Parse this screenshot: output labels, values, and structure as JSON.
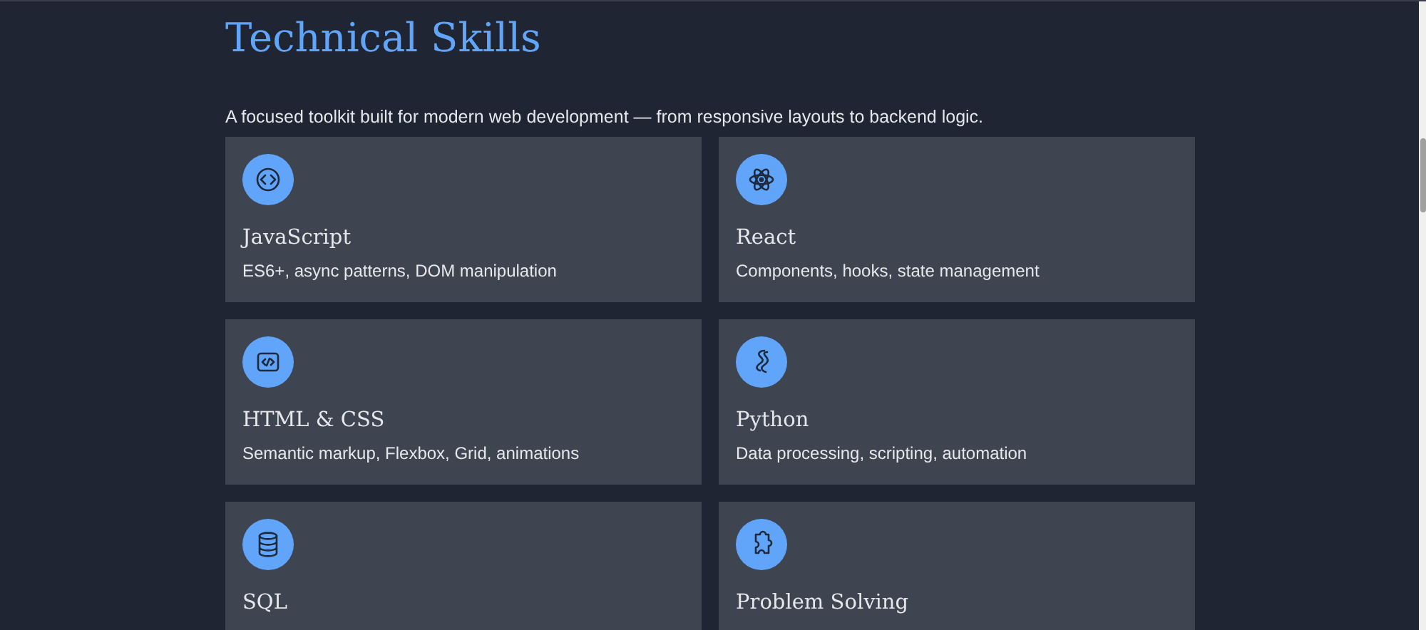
{
  "section": {
    "title": "Technical Skills",
    "subtitle": "A focused toolkit built for modern web development — from responsive layouts to backend logic."
  },
  "skills": [
    {
      "name": "JavaScript",
      "description": "ES6+, async patterns, DOM manipulation"
    },
    {
      "name": "React",
      "description": "Components, hooks, state management"
    },
    {
      "name": "HTML & CSS",
      "description": "Semantic markup, Flexbox, Grid, animations"
    },
    {
      "name": "Python",
      "description": "Data processing, scripting, automation"
    },
    {
      "name": "SQL"
    },
    {
      "name": "Problem Solving"
    }
  ]
}
